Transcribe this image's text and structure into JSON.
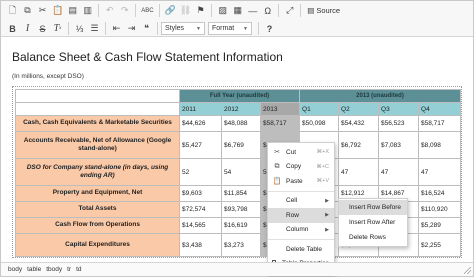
{
  "toolbar": {
    "row1": [
      {
        "name": "new-document-icon",
        "glyph": "🗋"
      },
      {
        "name": "copy-icon",
        "glyph": "⧉"
      },
      {
        "name": "cut-icon",
        "glyph": "✂"
      },
      {
        "name": "paste-icon",
        "glyph": "📋"
      },
      {
        "name": "paste-text-icon",
        "glyph": "▤"
      },
      {
        "name": "paste-word-icon",
        "glyph": "▥"
      },
      {
        "sep": true
      },
      {
        "name": "undo-icon",
        "glyph": "↶",
        "dim": true
      },
      {
        "name": "redo-icon",
        "glyph": "↷",
        "dim": true
      },
      {
        "sep": true
      },
      {
        "name": "spellcheck-icon",
        "glyph": "ABC"
      },
      {
        "sep": true
      },
      {
        "name": "link-icon",
        "glyph": "🔗"
      },
      {
        "name": "unlink-icon",
        "glyph": "⛓",
        "dim": true
      },
      {
        "name": "anchor-icon",
        "glyph": "⚑"
      },
      {
        "sep": true
      },
      {
        "name": "image-icon",
        "glyph": "▨"
      },
      {
        "name": "table-icon",
        "glyph": "▦"
      },
      {
        "name": "horizontal-line-icon",
        "glyph": "―"
      },
      {
        "name": "special-char-icon",
        "glyph": "Ω"
      },
      {
        "sep": true
      },
      {
        "name": "maximize-icon",
        "glyph": "⤢"
      },
      {
        "sep": true
      }
    ],
    "source_label": "Source",
    "styles_label": "Styles",
    "format_label": "Format",
    "help_glyph": "?"
  },
  "document": {
    "title": "Balance Sheet & Cash Flow Statement Information",
    "subtitle": "(In millions, except DSO)"
  },
  "table": {
    "group_headers": [
      "Full Year (unaudited)",
      "2013 (unaudited)"
    ],
    "years": [
      "2011",
      "2012",
      "2013",
      "Q1",
      "Q2",
      "Q3",
      "Q4"
    ],
    "rows": [
      {
        "label": "Cash, Cash Equivalents & Marketable Securities",
        "values": [
          "$44,626",
          "$48,088",
          "$58,717",
          "$50,098",
          "$54,432",
          "$56,523",
          "$58,717"
        ]
      },
      {
        "label": "Accounts Receivable, Net of Allowance (Google stand-alone)",
        "values": [
          "$5,427",
          "$6,769",
          "$8,...",
          "$6,...",
          "$6,792",
          "$7,083",
          "$8,098"
        ]
      },
      {
        "label": "DSO for Company stand-alone (in days, using ending AR)",
        "italic": true,
        "values": [
          "52",
          "54",
          "53",
          "",
          "47",
          "47",
          "47"
        ]
      },
      {
        "label": "Property and Equipment, Net",
        "values": [
          "$9,603",
          "$11,854",
          "$1...",
          "",
          "$12,912",
          "$14,867",
          "$16,524"
        ]
      },
      {
        "label": "Total Assets",
        "values": [
          "$72,574",
          "$93,798",
          "$1...",
          "",
          "$101,182",
          "$105,068",
          "$110,920"
        ]
      },
      {
        "label": "Cash Flow from Operations",
        "values": [
          "$14,565",
          "$16,619",
          "$1...",
          "",
          "$4,425",
          "$4,506",
          "$5,289"
        ]
      },
      {
        "label": "Capital Expenditures",
        "values": [
          "$3,438",
          "$3,273",
          "$...",
          "",
          "$1,0...",
          "",
          "$2,255"
        ]
      }
    ]
  },
  "context_menu": {
    "items": [
      {
        "label": "Cut",
        "shortcut": "⌘+X",
        "icon": "✂",
        "icon_name": "cut-icon",
        "dim": false
      },
      {
        "label": "Copy",
        "shortcut": "⌘+C",
        "icon": "⧉",
        "icon_name": "copy-icon",
        "dim": false
      },
      {
        "label": "Paste",
        "shortcut": "⌘+V",
        "icon": "📋",
        "icon_name": "paste-icon",
        "dim": false
      },
      {
        "label": "Cell",
        "submenu": true
      },
      {
        "label": "Row",
        "submenu": true,
        "hover": true
      },
      {
        "label": "Column",
        "submenu": true
      },
      {
        "label": "Delete Table"
      },
      {
        "label": "Table Properties",
        "icon_name": "table-properties-icon"
      }
    ],
    "row_submenu": [
      "Insert Row Before",
      "Insert Row After",
      "Delete Rows"
    ]
  },
  "statusbar": {
    "breadcrumbs": [
      "body",
      "table",
      "tbody",
      "tr",
      "td"
    ]
  },
  "colors": {
    "group_header_bg": "#5c8f96",
    "year_header_bg": "#93cfd5",
    "label_bg": "#f9c9a8",
    "selected_bg": "#bdbdbd"
  }
}
